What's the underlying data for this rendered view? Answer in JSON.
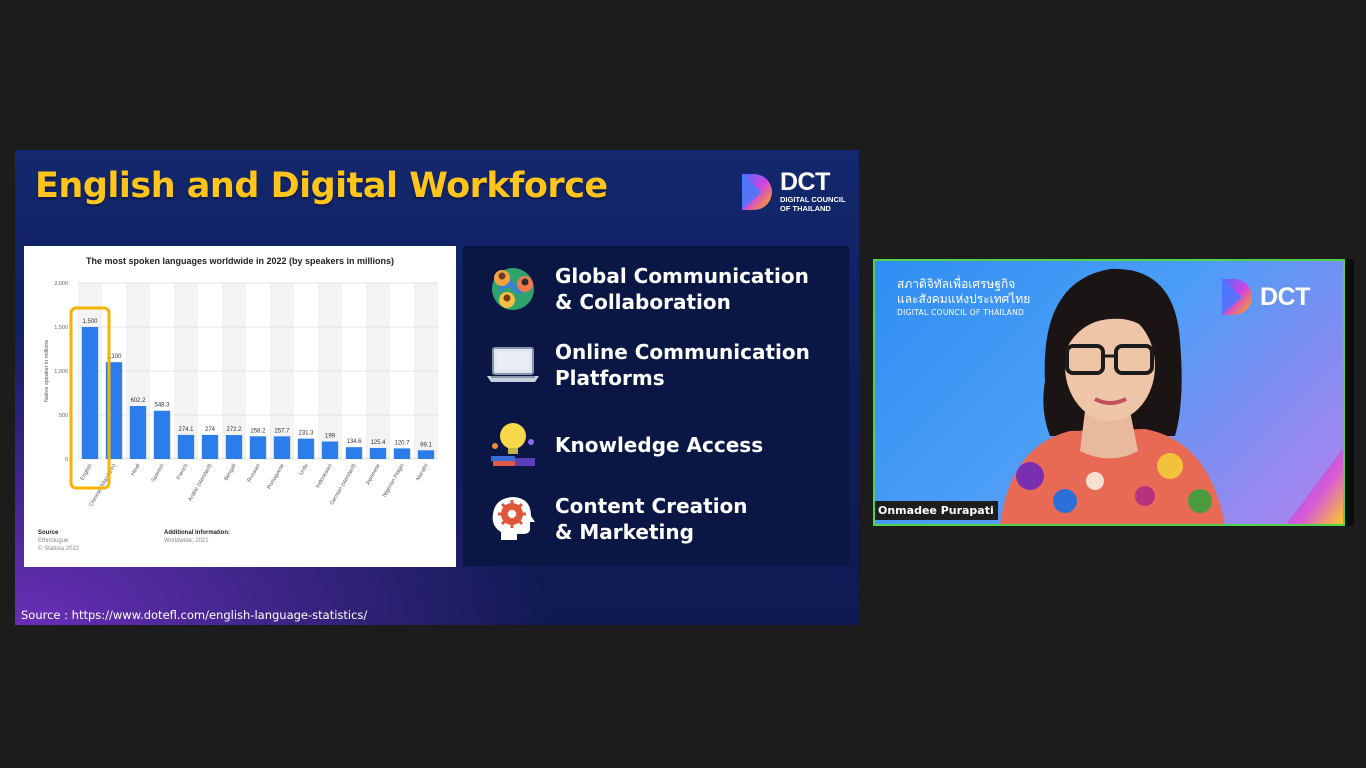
{
  "slide": {
    "title": "English and Digital Workforce",
    "logo": {
      "brand": "DCT",
      "sub1": "DIGITAL COUNCIL",
      "sub2": "OF THAILAND"
    },
    "source": "Source : https://www.dotefl.com/english-language-statistics/"
  },
  "chart_data": {
    "type": "bar",
    "title": "The most spoken languages worldwide in 2022 (by speakers in millions)",
    "ylabel": "Native speaker in millions",
    "ylim": [
      0,
      2000
    ],
    "yticks": [
      "2,000",
      "1,500",
      "1,000",
      "500",
      "0"
    ],
    "categories": [
      "English",
      "Chinese (Mandarin)",
      "Hindi",
      "Spanish",
      "French",
      "Arabic (standard)",
      "Bengali",
      "Russian",
      "Portuguese",
      "Urdu",
      "Indonesian",
      "German (standard)",
      "Japanese",
      "Nigerian Pidgin",
      "Marathi"
    ],
    "values": [
      1500,
      1100,
      602.2,
      548.3,
      274.1,
      274,
      272.2,
      258.2,
      257.7,
      231.3,
      199,
      134.6,
      125.4,
      120.7,
      99.1
    ],
    "value_labels": [
      "1,500",
      "1,100",
      "602.2",
      "548.3",
      "274.1",
      "274",
      "272.2",
      "258.2",
      "257.7",
      "231.3",
      "199",
      "134.6",
      "125.4",
      "120.7",
      "99.1"
    ],
    "bar_color": "#2b7de9",
    "highlight": {
      "category": "English",
      "color": "#f5b400"
    },
    "footer": {
      "source_label": "Source",
      "source_lines": [
        "Ethnologue",
        "© Statista 2022"
      ],
      "info_label": "Additional Information:",
      "info_lines": [
        "Worldwide; 2021"
      ]
    }
  },
  "topics": [
    {
      "label": "Global Communication\n& Collaboration",
      "icon": "people-globe-icon"
    },
    {
      "label": "Online Communication\nPlatforms",
      "icon": "laptop-icon"
    },
    {
      "label": "Knowledge Access",
      "icon": "lightbulb-books-icon"
    },
    {
      "label": "Content Creation\n& Marketing",
      "icon": "head-gear-icon"
    }
  ],
  "webcam": {
    "thai_line1": "สภาดิจิทัลเพื่อเศรษฐกิจ",
    "thai_line2": "และสังคมแห่งประเทศไทย",
    "org_en": "DIGITAL COUNCIL OF THAILAND",
    "logo_brand": "DCT",
    "participant_name": "Onmadee Purapati",
    "border_color": "#52d24a"
  },
  "colors": {
    "title_yellow": "#ffc51a",
    "slide_navy": "#14286e",
    "page_bg": "#1c1c1c"
  }
}
